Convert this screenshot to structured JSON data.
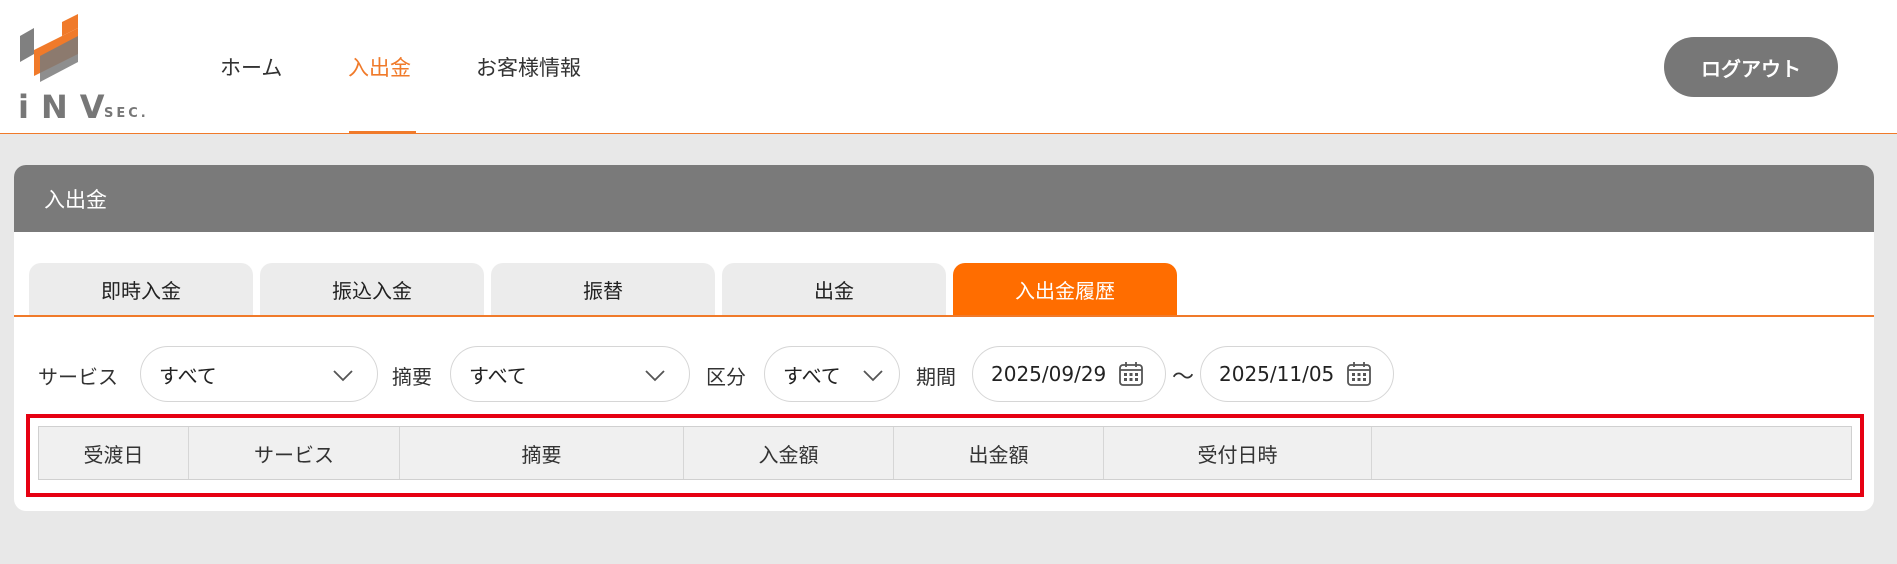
{
  "logo": {
    "text": "iNV",
    "sub": "SEC."
  },
  "nav": [
    {
      "label": "ホーム",
      "active": false
    },
    {
      "label": "入出金",
      "active": true
    },
    {
      "label": "お客様情報",
      "active": false
    }
  ],
  "header": {
    "logout_label": "ログアウト"
  },
  "card": {
    "title": "入出金",
    "tabs": [
      {
        "label": "即時入金",
        "active": false
      },
      {
        "label": "振込入金",
        "active": false
      },
      {
        "label": "振替",
        "active": false
      },
      {
        "label": "出金",
        "active": false
      },
      {
        "label": "入出金履歴",
        "active": true
      }
    ]
  },
  "filters": {
    "service": {
      "label": "サービス",
      "value": "すべて"
    },
    "summary": {
      "label": "摘要",
      "value": "すべて"
    },
    "category": {
      "label": "区分",
      "value": "すべて"
    },
    "period": {
      "label": "期間",
      "from": "2025/09/29",
      "separator": "～",
      "to": "2025/11/05"
    }
  },
  "table": {
    "columns": [
      "受渡日",
      "サービス",
      "摘要",
      "入金額",
      "出金額",
      "受付日時"
    ]
  },
  "colors": {
    "accent": "#ff6d00",
    "header_gray": "#7a7a7a",
    "highlight": "#e60012"
  }
}
